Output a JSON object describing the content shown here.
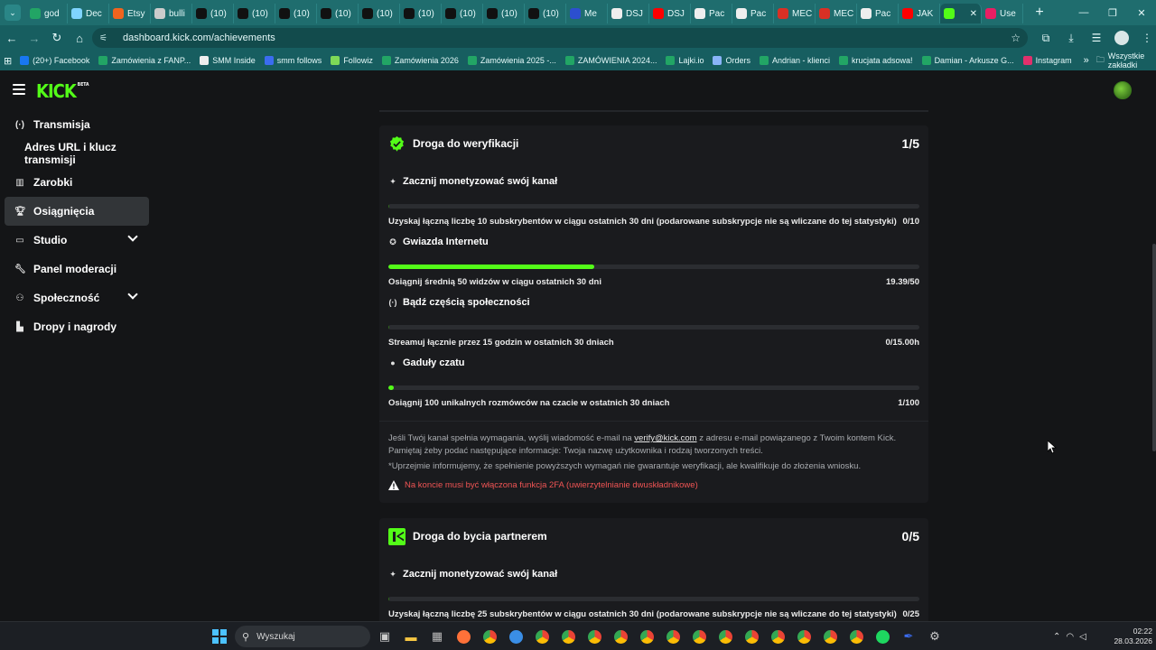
{
  "browser": {
    "tabs": [
      {
        "label": "god",
        "icon": "sheets-icon",
        "color": "#22a565"
      },
      {
        "label": "Dec",
        "icon": "globe-icon",
        "color": "#7fd4ff"
      },
      {
        "label": "Etsy",
        "icon": "etsy-icon",
        "color": "#f1641e"
      },
      {
        "label": "bulli",
        "icon": "chrome-icon",
        "color": "#cccccc"
      },
      {
        "label": "(10)",
        "icon": "tiktok-icon",
        "color": "#111111"
      },
      {
        "label": "(10)",
        "icon": "tiktok-icon",
        "color": "#111111"
      },
      {
        "label": "(10)",
        "icon": "tiktok-icon",
        "color": "#111111"
      },
      {
        "label": "(10)",
        "icon": "tiktok-icon",
        "color": "#111111"
      },
      {
        "label": "(10)",
        "icon": "tiktok-icon",
        "color": "#111111"
      },
      {
        "label": "(10)",
        "icon": "tiktok-icon",
        "color": "#111111"
      },
      {
        "label": "(10)",
        "icon": "tiktok-icon",
        "color": "#111111"
      },
      {
        "label": "(10)",
        "icon": "tiktok-icon",
        "color": "#111111"
      },
      {
        "label": "(10)",
        "icon": "tiktok-icon",
        "color": "#111111"
      },
      {
        "label": "Me",
        "icon": "feather-icon",
        "color": "#2c4fcf"
      },
      {
        "label": "DSJ",
        "icon": "chrome-icon",
        "color": "#eeeeee"
      },
      {
        "label": "DSJ",
        "icon": "youtube-icon",
        "color": "#ff0000"
      },
      {
        "label": "Pac",
        "icon": "chrome-icon",
        "color": "#eeeeee"
      },
      {
        "label": "Pac",
        "icon": "chrome-icon",
        "color": "#eeeeee"
      },
      {
        "label": "MEC",
        "icon": "gmail-icon",
        "color": "#d93025"
      },
      {
        "label": "MEC",
        "icon": "gmail-icon",
        "color": "#d93025"
      },
      {
        "label": "Pac",
        "icon": "chrome-icon",
        "color": "#eeeeee"
      },
      {
        "label": "JAK",
        "icon": "youtube-icon",
        "color": "#ff0000"
      },
      {
        "label": "",
        "icon": "kick-icon",
        "color": "#53fc18",
        "active": true
      },
      {
        "label": "Use",
        "icon": "kick-icon",
        "color": "#e91e63"
      }
    ],
    "url": "dashboard.kick.com/achievements",
    "bookmarks": [
      {
        "label": "(20+) Facebook",
        "color": "#1877f2"
      },
      {
        "label": "Zamówienia z FANP...",
        "color": "#22a565"
      },
      {
        "label": "SMM Inside",
        "color": "#eeeeee"
      },
      {
        "label": "smm follows",
        "color": "#3b6cf0"
      },
      {
        "label": "Followiz",
        "color": "#7ed957"
      },
      {
        "label": "Zamówienia 2026",
        "color": "#22a565"
      },
      {
        "label": "Zamówienia 2025 -...",
        "color": "#22a565"
      },
      {
        "label": "ZAMÓWIENIA 2024...",
        "color": "#22a565"
      },
      {
        "label": "Lajki.io",
        "color": "#22a565"
      },
      {
        "label": "Orders",
        "color": "#8ab4f8"
      },
      {
        "label": "Andrian - klienci",
        "color": "#22a565"
      },
      {
        "label": "krucjata adsowa!",
        "color": "#22a565"
      },
      {
        "label": "Damian - Arkusze G...",
        "color": "#22a565"
      },
      {
        "label": "Instagram",
        "color": "#e1306c"
      }
    ],
    "all_bookmarks": "Wszystkie zakładki"
  },
  "kick": {
    "logo": "KICK",
    "logo_badge": "BETA"
  },
  "sidebar": {
    "items": [
      {
        "label": "Transmisja",
        "icon": "broadcast-icon"
      },
      {
        "label": "Adres URL i klucz transmisji",
        "icon": ""
      },
      {
        "label": "Zarobki",
        "icon": "chart-icon"
      },
      {
        "label": "Osiągnięcia",
        "icon": "trophy-icon"
      },
      {
        "label": "Studio",
        "icon": "studio-icon"
      },
      {
        "label": "Panel moderacji",
        "icon": "wrench-icon"
      },
      {
        "label": "Społeczność",
        "icon": "community-icon"
      },
      {
        "label": "Dropy i nagrody",
        "icon": "drops-icon"
      }
    ]
  },
  "verification": {
    "title": "Droga do weryfikacji",
    "score": "1/5",
    "requirements": [
      {
        "title": "Zacznij monetyzować swój kanał",
        "desc": "Uzyskaj łączną liczbę 10 subskrybentów w ciągu ostatnich 30 dni (podarowane subskrypcje nie są wliczane do tej statystyki)",
        "value": "0/10",
        "progress": 0
      },
      {
        "title": "Gwiazda Internetu",
        "desc": "Osiągnij średnią 50 widzów w ciągu ostatnich 30 dni",
        "value": "19.39/50",
        "progress": 0.3878
      },
      {
        "title": "Bądź częścią społeczności",
        "desc": "Streamuj łącznie przez 15 godzin w ostatnich 30 dniach",
        "value": "0/15.00h",
        "progress": 0
      },
      {
        "title": "Gaduły czatu",
        "desc": "Osiągnij 100 unikalnych rozmówców na czacie w ostatnich 30 dniach",
        "value": "1/100",
        "progress": 0.01
      }
    ],
    "info_before": "Jeśli Twój kanał spełnia wymagania, wyślij wiadomość e-mail na ",
    "info_email": "verify@kick.com",
    "info_after": " z adresu e-mail powiązanego z Twoim kontem Kick. Pamiętaj żeby podać następujące informacje: Twoja nazwę użytkownika i rodzaj tworzonych treści.",
    "info_note": "*Uprzejmie informujemy, że spełnienie powyższych wymagań nie gwarantuje weryfikacji, ale kwalifikuje do złożenia wniosku.",
    "warning": "Na koncie musi być włączona funkcja 2FA (uwierzytelnianie dwuskładnikowe)"
  },
  "partner": {
    "title": "Droga do bycia partnerem",
    "score": "0/5",
    "requirements": [
      {
        "title": "Zacznij monetyzować swój kanał",
        "desc": "Uzyskaj łączną liczbę 25 subskrybentów w ciągu ostatnich 30 dni (podarowane subskrypcje nie są wliczane do tej statystyki)",
        "value": "0/25",
        "progress": 0
      }
    ]
  },
  "colors": {
    "accent": "#53fc18",
    "warning": "#f05454"
  },
  "taskbar": {
    "search_placeholder": "Wyszukaj",
    "time": "02:22",
    "date": "28.03.2026"
  }
}
